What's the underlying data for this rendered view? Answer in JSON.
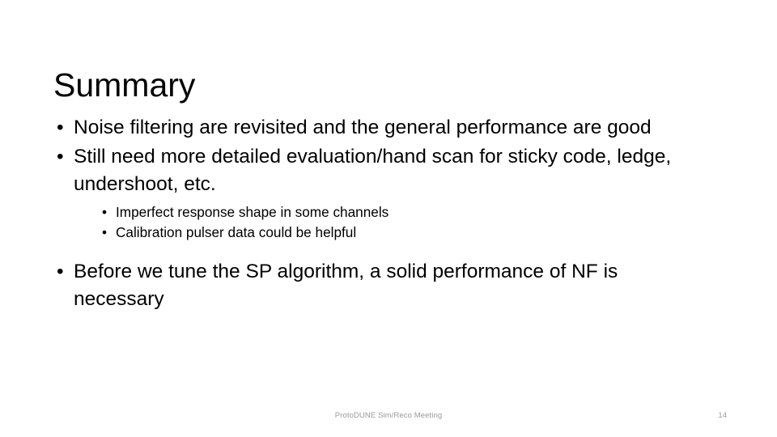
{
  "slide": {
    "title": "Summary",
    "background_color": "#ffffff",
    "text_color": "#000000",
    "footer_color": "#9a9a9a",
    "bullet_glyph": "•"
  },
  "content": {
    "bullets": [
      {
        "level": 1,
        "text": "Noise filtering are revisited and the general performance are good"
      },
      {
        "level": 1,
        "text": "Still need more detailed evaluation/hand scan for sticky code, ledge, undershoot, etc."
      },
      {
        "level": 2,
        "text": "Imperfect response shape in some channels"
      },
      {
        "level": 2,
        "text": "Calibration pulser data could be helpful"
      },
      {
        "level": 1,
        "text": "Before we tune the SP algorithm, a solid performance of NF is necessary"
      }
    ]
  },
  "footer": {
    "note": "ProtoDUNE Sim/Reco Meeting",
    "slide_number": "14"
  }
}
